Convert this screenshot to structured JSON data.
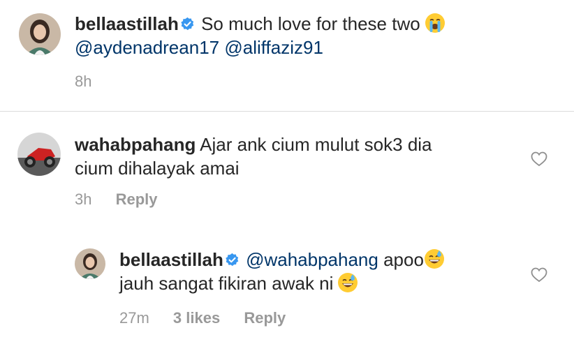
{
  "caption": {
    "username": "bellaastillah",
    "text": "So much love for these two",
    "mentions": [
      "@aydenadrean17",
      "@aliffaziz91"
    ],
    "time": "8h",
    "emoji": "loudly-crying-face"
  },
  "comments": [
    {
      "username": "wahabpahang",
      "text_line1": "Ajar ank cium mulut sok3 dia",
      "text_line2": "cium dihalayak amai",
      "time": "3h",
      "reply_label": "Reply"
    }
  ],
  "reply": {
    "username": "bellaastillah",
    "mention": "@wahabpahang",
    "text_line1": "apoo",
    "text_line2": "jauh sangat fikiran awak ni",
    "time": "27m",
    "likes": "3 likes",
    "reply_label": "Reply",
    "emoji": "grinning-face-with-sweat"
  },
  "colors": {
    "verified": "#3897f0",
    "mention": "#003569",
    "meta": "#999999"
  }
}
